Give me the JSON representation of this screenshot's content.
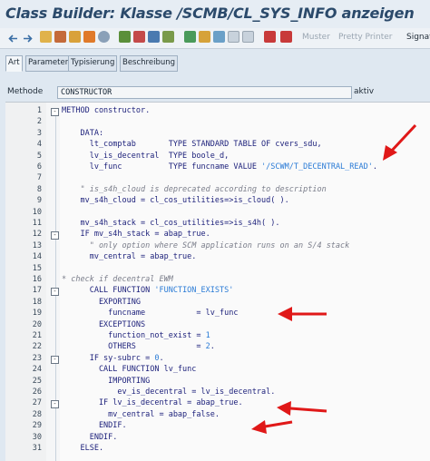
{
  "title": "Class Builder: Klasse /SCMB/CL_SYS_INFO anzeigen",
  "toolbar": {
    "muster_label": "Muster",
    "pretty_printer_label": "Pretty Printer",
    "signatur_label": "Signat"
  },
  "tabs": [
    "Art",
    "Parameter",
    "Typisierung",
    "Beschreibung"
  ],
  "method_field": {
    "label": "Methode",
    "value": "CONSTRUCTOR",
    "status": "aktiv"
  },
  "code_lines": [
    {
      "n": "1",
      "text": "METHOD constructor."
    },
    {
      "n": "2",
      "text": ""
    },
    {
      "n": "3",
      "text": "    DATA:"
    },
    {
      "n": "4",
      "text": "      lt_comptab       TYPE STANDARD TABLE OF cvers_sdu,"
    },
    {
      "n": "5",
      "text": "      lv_is_decentral  TYPE boole_d,"
    },
    {
      "n": "6",
      "text": "      lv_func          TYPE funcname VALUE '/SCWM/T_DECENTRAL_READ'."
    },
    {
      "n": "7",
      "text": ""
    },
    {
      "n": "8",
      "text": "    \" is_s4h_cloud is deprecated according to description"
    },
    {
      "n": "9",
      "text": "    mv_s4h_cloud = cl_cos_utilities=>is_cloud( )."
    },
    {
      "n": "10",
      "text": ""
    },
    {
      "n": "11",
      "text": "    mv_s4h_stack = cl_cos_utilities=>is_s4h( )."
    },
    {
      "n": "12",
      "text": "    IF mv_s4h_stack = abap_true."
    },
    {
      "n": "13",
      "text": "      \" only option where SCM application runs on an S/4 stack"
    },
    {
      "n": "14",
      "text": "      mv_central = abap_true."
    },
    {
      "n": "15",
      "text": ""
    },
    {
      "n": "16",
      "text": "* check if decentral EWM"
    },
    {
      "n": "17",
      "text": "      CALL FUNCTION 'FUNCTION_EXISTS'"
    },
    {
      "n": "18",
      "text": "        EXPORTING"
    },
    {
      "n": "19",
      "text": "          funcname           = lv_func"
    },
    {
      "n": "20",
      "text": "        EXCEPTIONS"
    },
    {
      "n": "21",
      "text": "          function_not_exist = 1"
    },
    {
      "n": "22",
      "text": "          OTHERS             = 2."
    },
    {
      "n": "23",
      "text": "      IF sy-subrc = 0."
    },
    {
      "n": "24",
      "text": "        CALL FUNCTION lv_func"
    },
    {
      "n": "25",
      "text": "          IMPORTING"
    },
    {
      "n": "26",
      "text": "            ev_is_decentral = lv_is_decentral."
    },
    {
      "n": "27",
      "text": "        IF lv_is_decentral = abap_true."
    },
    {
      "n": "28",
      "text": "          mv_central = abap_false."
    },
    {
      "n": "29",
      "text": "        ENDIF."
    },
    {
      "n": "30",
      "text": "      ENDIF."
    },
    {
      "n": "31",
      "text": "    ELSE."
    }
  ],
  "colors": {
    "keyword": "#1b1f7a",
    "string": "#2a7bd6",
    "comment": "#7a7d8a",
    "arrow": "#e01818"
  }
}
